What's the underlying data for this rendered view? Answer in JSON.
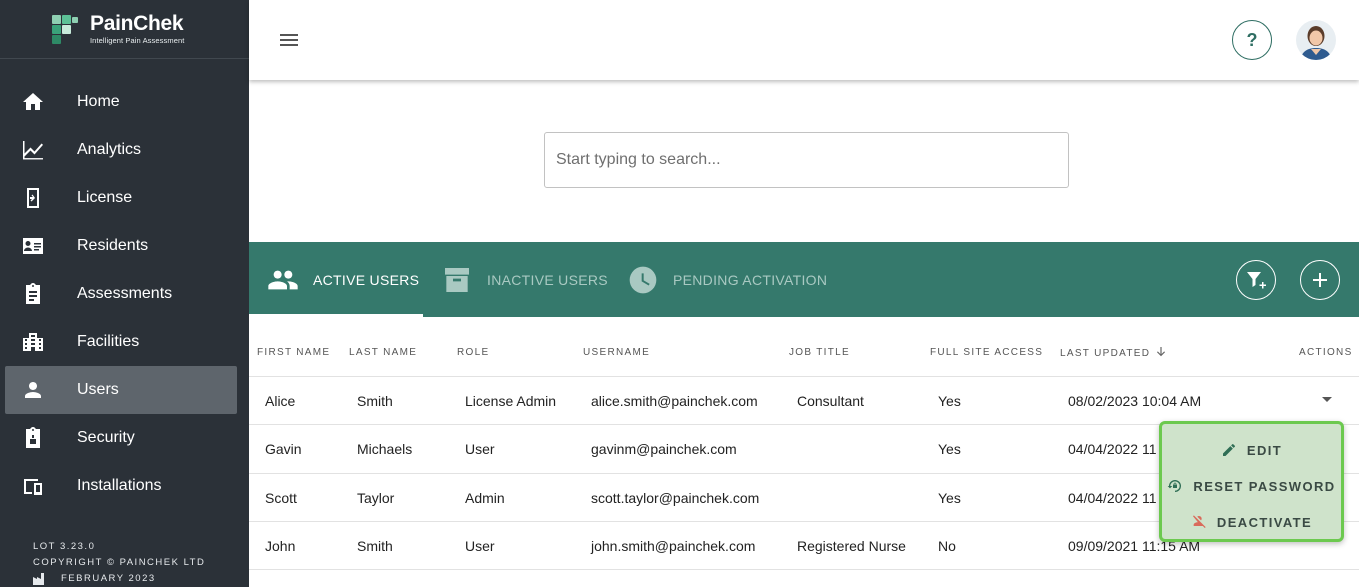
{
  "brand": {
    "name": "PainChek",
    "tagline": "Intelligent Pain Assessment",
    "colors": {
      "sidebar": "#2b3138",
      "teal": "#35796c",
      "popup_border": "#6cc94f"
    }
  },
  "sidebar": {
    "items": [
      {
        "label": "Home",
        "icon": "home-icon"
      },
      {
        "label": "Analytics",
        "icon": "analytics-icon"
      },
      {
        "label": "License",
        "icon": "license-icon"
      },
      {
        "label": "Residents",
        "icon": "residents-icon"
      },
      {
        "label": "Assessments",
        "icon": "assessments-icon"
      },
      {
        "label": "Facilities",
        "icon": "facilities-icon"
      },
      {
        "label": "Users",
        "icon": "user-icon",
        "active": true
      },
      {
        "label": "Security",
        "icon": "security-icon"
      },
      {
        "label": "Installations",
        "icon": "installations-icon"
      }
    ],
    "footer": {
      "lot": "LOT 3.23.0",
      "copyright": "COPYRIGHT © PAINCHEK LTD",
      "date": "FEBRUARY 2023"
    }
  },
  "header": {
    "help_label": "?"
  },
  "search": {
    "placeholder": "Start typing to search..."
  },
  "tabs": [
    {
      "label": "ACTIVE USERS",
      "icon": "people-icon",
      "active": true
    },
    {
      "label": "INACTIVE USERS",
      "icon": "archive-icon",
      "active": false
    },
    {
      "label": "PENDING ACTIVATION",
      "icon": "clock-icon",
      "active": false
    }
  ],
  "table": {
    "columns": [
      "FIRST NAME",
      "LAST NAME",
      "ROLE",
      "USERNAME",
      "JOB TITLE",
      "FULL SITE ACCESS",
      "LAST UPDATED",
      "ACTIONS"
    ],
    "rows": [
      {
        "first": "Alice",
        "last": "Smith",
        "role": "License Admin",
        "username": "alice.smith@painchek.com",
        "job": "Consultant",
        "access": "Yes",
        "updated": "08/02/2023 10:04 AM"
      },
      {
        "first": "Gavin",
        "last": "Michaels",
        "role": "User",
        "username": "gavinm@painchek.com",
        "job": "",
        "access": "Yes",
        "updated": "04/04/2022 11"
      },
      {
        "first": "Scott",
        "last": "Taylor",
        "role": "Admin",
        "username": "scott.taylor@painchek.com",
        "job": "",
        "access": "Yes",
        "updated": "04/04/2022 11"
      },
      {
        "first": "John",
        "last": "Smith",
        "role": "User",
        "username": "john.smith@painchek.com",
        "job": "Registered Nurse",
        "access": "No",
        "updated": "09/09/2021 11:15 AM"
      }
    ]
  },
  "actions_menu": {
    "items": [
      {
        "label": "EDIT",
        "icon": "pencil-icon"
      },
      {
        "label": "RESET PASSWORD",
        "icon": "lock-reset-icon"
      },
      {
        "label": "DEACTIVATE",
        "icon": "person-off-icon"
      }
    ]
  }
}
